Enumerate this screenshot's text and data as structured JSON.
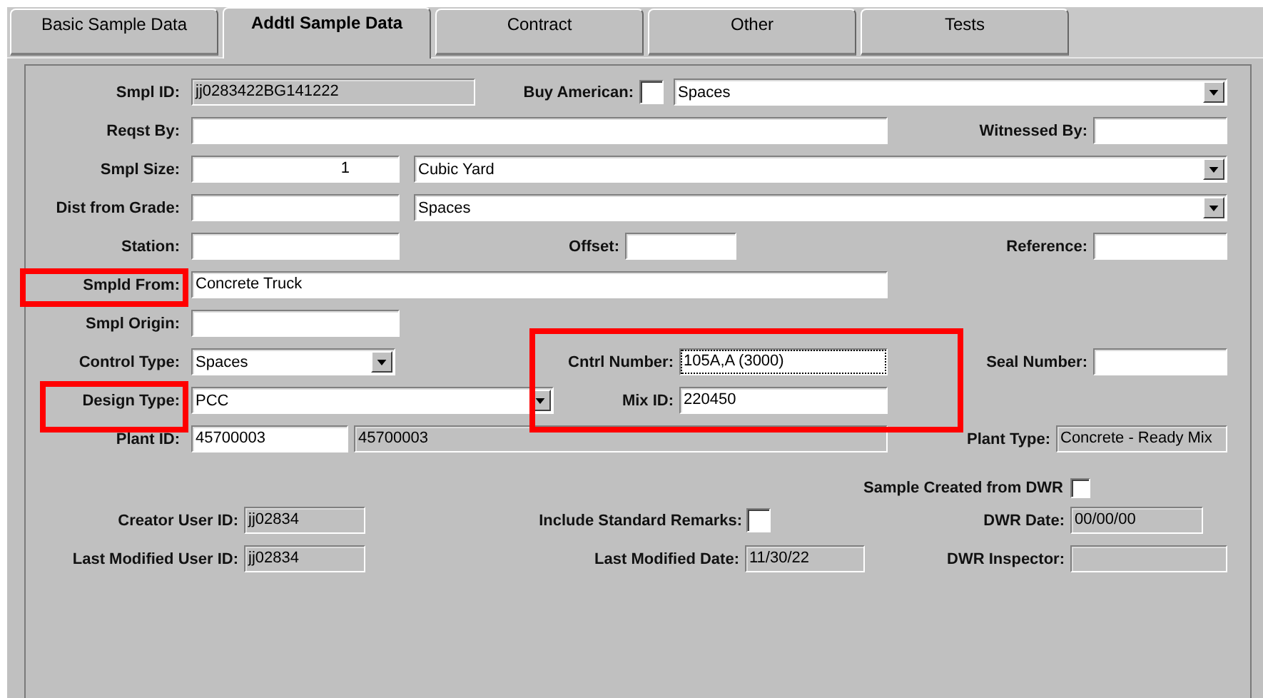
{
  "tabs": [
    {
      "label": "Basic Sample Data",
      "selected": false
    },
    {
      "label": "Addtl Sample Data",
      "selected": true
    },
    {
      "label": "Contract",
      "selected": false
    },
    {
      "label": "Other",
      "selected": false
    },
    {
      "label": "Tests",
      "selected": false
    }
  ],
  "form": {
    "rows": [
      {
        "items": [
          {
            "kind": "label",
            "text": "Smpl ID:"
          },
          {
            "kind": "readonly",
            "value": "jj0283422BG141222"
          },
          {
            "kind": "label",
            "text": "Buy American:"
          },
          {
            "kind": "checkbox",
            "checked": false
          },
          {
            "kind": "dropdown",
            "value": "Spaces",
            "focused": false
          }
        ]
      },
      {
        "items": [
          {
            "kind": "label",
            "text": "Reqst By:"
          },
          {
            "kind": "text",
            "value": "",
            "focused": false
          },
          {
            "kind": "label",
            "text": "Witnessed By:"
          },
          {
            "kind": "text",
            "value": "",
            "focused": false
          }
        ]
      },
      {
        "items": [
          {
            "kind": "label",
            "text": "Smpl Size:"
          },
          {
            "kind": "number",
            "value": "1",
            "focused": false
          },
          {
            "kind": "dropdown",
            "value": "Cubic Yard",
            "focused": false
          }
        ]
      },
      {
        "items": [
          {
            "kind": "label",
            "text": "Dist from Grade:"
          },
          {
            "kind": "text",
            "value": "",
            "focused": false
          },
          {
            "kind": "dropdown",
            "value": "Spaces",
            "focused": false
          }
        ]
      },
      {
        "items": [
          {
            "kind": "label",
            "text": "Station:"
          },
          {
            "kind": "text",
            "value": "",
            "focused": false
          },
          {
            "kind": "label",
            "text": "Offset:"
          },
          {
            "kind": "text",
            "value": "",
            "focused": false
          },
          {
            "kind": "label",
            "text": "Reference:"
          },
          {
            "kind": "text",
            "value": "",
            "focused": false
          }
        ]
      },
      {
        "items": [
          {
            "kind": "label",
            "text": "Smpld From:"
          },
          {
            "kind": "text",
            "value": "Concrete Truck",
            "focused": false
          }
        ]
      },
      {
        "items": [
          {
            "kind": "label",
            "text": "Smpl Origin:"
          },
          {
            "kind": "text",
            "value": "",
            "focused": false
          }
        ]
      },
      {
        "items": [
          {
            "kind": "label",
            "text": "Control Type:"
          },
          {
            "kind": "dropdown",
            "value": "Spaces",
            "focused": false
          },
          {
            "kind": "label",
            "text": "Cntrl Number:"
          },
          {
            "kind": "text",
            "value": "105A,A (3000)",
            "focused": true
          },
          {
            "kind": "label",
            "text": "Seal Number:"
          },
          {
            "kind": "text",
            "value": "",
            "focused": false
          }
        ]
      },
      {
        "items": [
          {
            "kind": "label",
            "text": "Design Type:"
          },
          {
            "kind": "dropdown",
            "value": "PCC",
            "focused": false
          },
          {
            "kind": "label",
            "text": "Mix ID:"
          },
          {
            "kind": "text",
            "value": "220450",
            "focused": false
          }
        ]
      },
      {
        "items": [
          {
            "kind": "label",
            "text": "Plant ID:"
          },
          {
            "kind": "text",
            "value": "45700003",
            "focused": false
          },
          {
            "kind": "readonly",
            "value": "45700003"
          },
          {
            "kind": "label",
            "text": "Plant Type:"
          },
          {
            "kind": "readonly",
            "value": "Concrete - Ready Mix"
          }
        ]
      },
      {
        "items": [
          {
            "kind": "label",
            "text": "Sample Created from DWR"
          },
          {
            "kind": "checkbox",
            "checked": false
          }
        ]
      },
      {
        "items": [
          {
            "kind": "label",
            "text": "Creator User ID:"
          },
          {
            "kind": "readonly",
            "value": "jj02834"
          },
          {
            "kind": "label",
            "text": "Include Standard Remarks:"
          },
          {
            "kind": "checkbox",
            "checked": false
          },
          {
            "kind": "label",
            "text": "DWR Date:"
          },
          {
            "kind": "readonly",
            "value": "00/00/00"
          }
        ]
      },
      {
        "items": [
          {
            "kind": "label",
            "text": "Last Modified User ID:"
          },
          {
            "kind": "readonly",
            "value": "jj02834"
          },
          {
            "kind": "label",
            "text": "Last Modified Date:"
          },
          {
            "kind": "readonly",
            "value": "11/30/22"
          },
          {
            "kind": "label",
            "text": "DWR Inspector:"
          },
          {
            "kind": "readonly",
            "value": ""
          }
        ]
      }
    ]
  },
  "annotations": [
    {
      "color": "#ff0000"
    },
    {
      "color": "#ff0000"
    },
    {
      "color": "#ff0000"
    }
  ]
}
